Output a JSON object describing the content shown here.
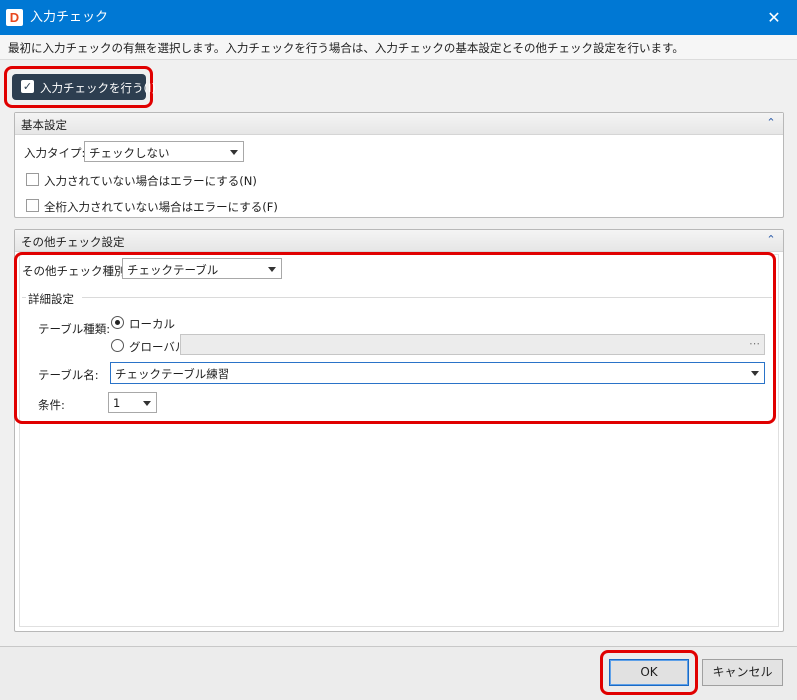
{
  "window": {
    "app_icon_letter": "D",
    "title": "入力チェック",
    "close_glyph": "✕"
  },
  "description": "最初に入力チェックの有無を選択します。入力チェックを行う場合は、入力チェックの基本設定とその他チェック設定を行います。",
  "enable_check": {
    "label": "入力チェックを行う(I)",
    "checked": true,
    "check_glyph": "✓"
  },
  "basic": {
    "title": "基本設定",
    "collapse_glyph": "⌃",
    "input_type_label": "入力タイプ:",
    "input_type_value": "チェックしない",
    "required_error_label": "入力されていない場合はエラーにする(N)",
    "required_error_checked": false,
    "fulldigit_error_label": "全桁入力されていない場合はエラーにする(F)",
    "fulldigit_error_checked": false
  },
  "other": {
    "title": "その他チェック設定",
    "collapse_glyph": "⌃",
    "kind_label": "その他チェック種別:",
    "kind_value": "チェックテーブル",
    "detail_title": "詳細設定",
    "table_kind_label": "テーブル種類:",
    "radio_local": "ローカル",
    "radio_global": "グローバル:",
    "selected_table_kind": "local",
    "global_browse_glyph": "⋯",
    "table_name_label": "テーブル名:",
    "table_name_value": "チェックテーブル練習",
    "condition_label": "条件:",
    "condition_value": "1"
  },
  "footer": {
    "ok_label": "OK",
    "cancel_label": "キャンセル"
  },
  "colors": {
    "titlebar": "#0078d4",
    "highlight": "#e00000",
    "enable_button": "#2d3e50"
  }
}
